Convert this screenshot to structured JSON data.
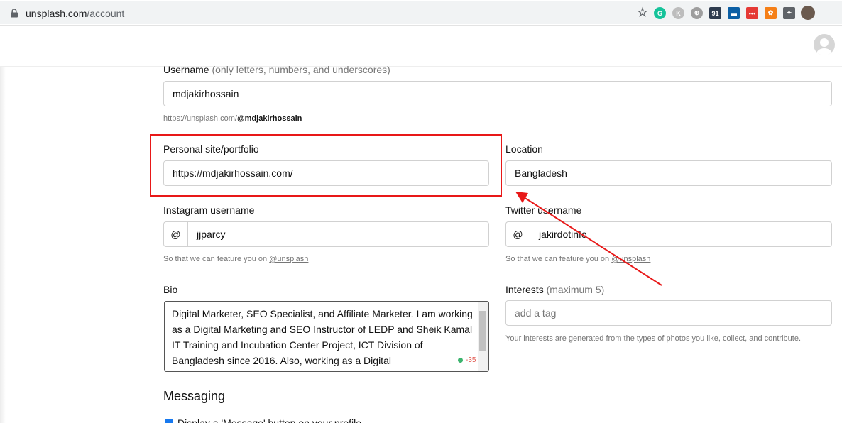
{
  "browser": {
    "url_host": "unsplash.com",
    "url_path": "/account",
    "extensions": [
      {
        "name": "grammarly",
        "label": "G",
        "color": "#15c39a"
      },
      {
        "name": "k-extension",
        "label": "K",
        "color": "#bdbdbd"
      },
      {
        "name": "globe",
        "label": "⊕",
        "color": "#9e9e9e"
      },
      {
        "name": "91",
        "label": "91",
        "color": "#2e3b4e"
      },
      {
        "name": "mail",
        "label": "▬",
        "color": "#0b5fa5"
      },
      {
        "name": "red-dots",
        "label": "•••",
        "color": "#e53935"
      },
      {
        "name": "flower",
        "label": "✿",
        "color": "#f57f17"
      },
      {
        "name": "puzzle",
        "label": "✦",
        "color": "#5f6368"
      }
    ]
  },
  "form": {
    "username_label": "Username",
    "username_hint": "(only letters, numbers, and underscores)",
    "username_value": "mdjakirhossain",
    "profile_url_prefix": "https://unsplash.com/",
    "profile_url_handle": "@mdjakirhossain",
    "site_label": "Personal site/portfolio",
    "site_value": "https://mdjakirhossain.com/",
    "location_label": "Location",
    "location_value": "Bangladesh",
    "instagram_label": "Instagram username",
    "instagram_prefix": "@",
    "instagram_value": "jjparcy",
    "instagram_hint": "So that we can feature you on ",
    "instagram_hint_link": "@unsplash",
    "twitter_label": "Twitter username",
    "twitter_prefix": "@",
    "twitter_value": "jakirdotinfo",
    "twitter_hint": "So that we can feature you on ",
    "twitter_hint_link": "@unsplash",
    "bio_label": "Bio",
    "bio_value": "Digital Marketer, SEO Specialist, and Affiliate Marketer. I am working as a Digital Marketing and SEO Instructor of LEDP and Sheik Kamal IT Training and Incubation Center Project, ICT Division of Bangladesh since 2016. Also, working as a Digital",
    "bio_counter": "-35",
    "interests_label": "Interests",
    "interests_hint_label": "(maximum 5)",
    "interests_placeholder": "add a tag",
    "interests_note": "Your interests are generated from the types of photos you like, collect, and contribute.",
    "messaging_heading": "Messaging",
    "messaging_checkbox_label": "Display a 'Message' button on your profile"
  },
  "annotation": {
    "highlight_color": "#e81818"
  }
}
